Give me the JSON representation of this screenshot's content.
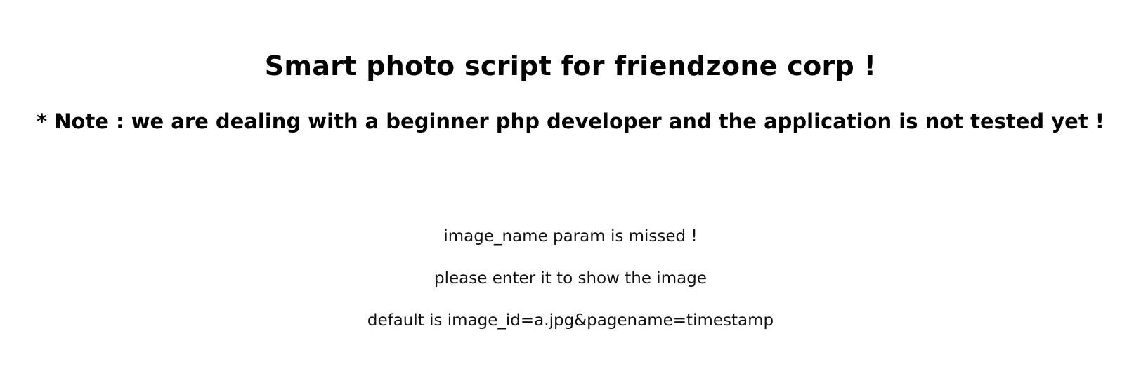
{
  "page": {
    "title": "Smart photo script for friendzone corp !",
    "note": "* Note : we are dealing with a beginner php developer and the application is not tested yet !"
  },
  "messages": {
    "missing_param": "image_name param is missed !",
    "instruction": "please enter it to show the image",
    "default_hint": "default is image_id=a.jpg&pagename=timestamp"
  }
}
